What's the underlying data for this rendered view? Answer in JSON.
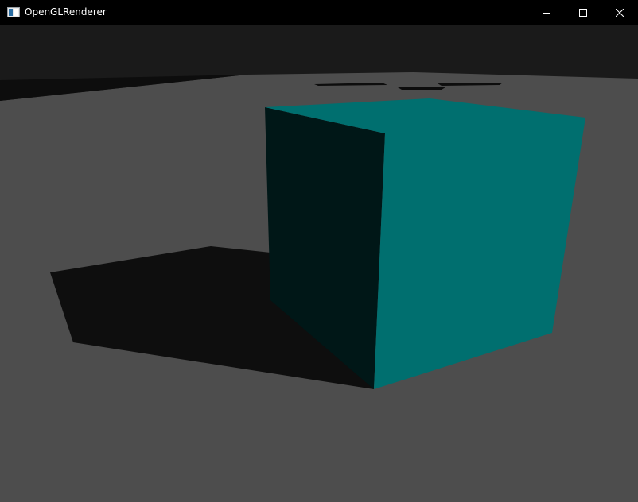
{
  "window": {
    "title": "OpenGLRenderer",
    "controls": {
      "minimize": "minimize-icon",
      "maximize": "maximize-icon",
      "close": "close-icon"
    }
  },
  "scene": {
    "colors": {
      "sky": "#1a1a1a",
      "floor": "#4d4d4d",
      "far_floor_shadow": "#0d0d0d",
      "cube_shadow": "#0e0e0e",
      "cube_front": "#006f6f",
      "cube_side": "#001717"
    }
  }
}
